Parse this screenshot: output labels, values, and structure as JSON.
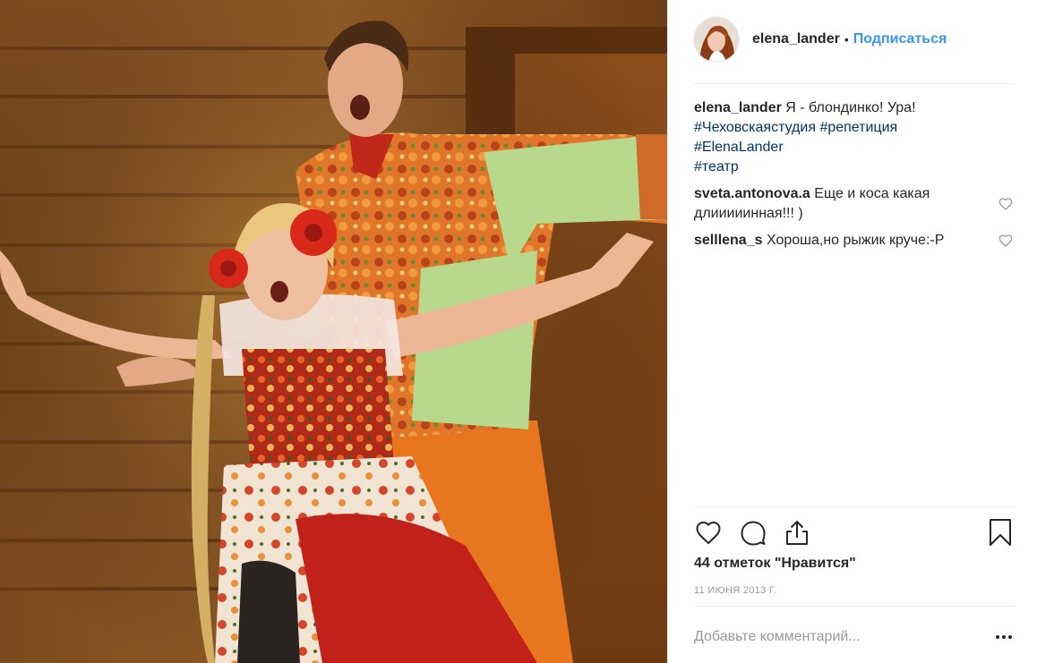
{
  "header": {
    "username": "elena_lander",
    "separator": "•",
    "follow_label": "Подписаться"
  },
  "caption": {
    "user": "elena_lander",
    "text": "Я - блондинко! Ура!",
    "hashtags": [
      "#Чеховскаястудия",
      "#репетиция",
      "#ElenaLander",
      "#театр"
    ]
  },
  "comments": [
    {
      "user": "sveta.antonova.a",
      "text": "Еще и коса какая длииииинная!!! )"
    },
    {
      "user": "selllena_s",
      "text": "Хороша,но рыжик круче:-P"
    }
  ],
  "actions": {
    "like_icon": "heart-outline-icon",
    "comment_icon": "speech-bubble-icon",
    "share_icon": "share-upload-icon",
    "save_icon": "bookmark-icon"
  },
  "likes_text": "44 отметок \"Нравится\"",
  "date": "11 ИЮНЯ 2013 Г.",
  "add_comment": {
    "placeholder": "Добавьте комментарий...",
    "more_icon": "more-dots-icon"
  },
  "colors": {
    "accent": "#3897f0",
    "hashtag": "#003569",
    "text": "#262626",
    "muted": "#999999",
    "divider": "#efefef"
  }
}
